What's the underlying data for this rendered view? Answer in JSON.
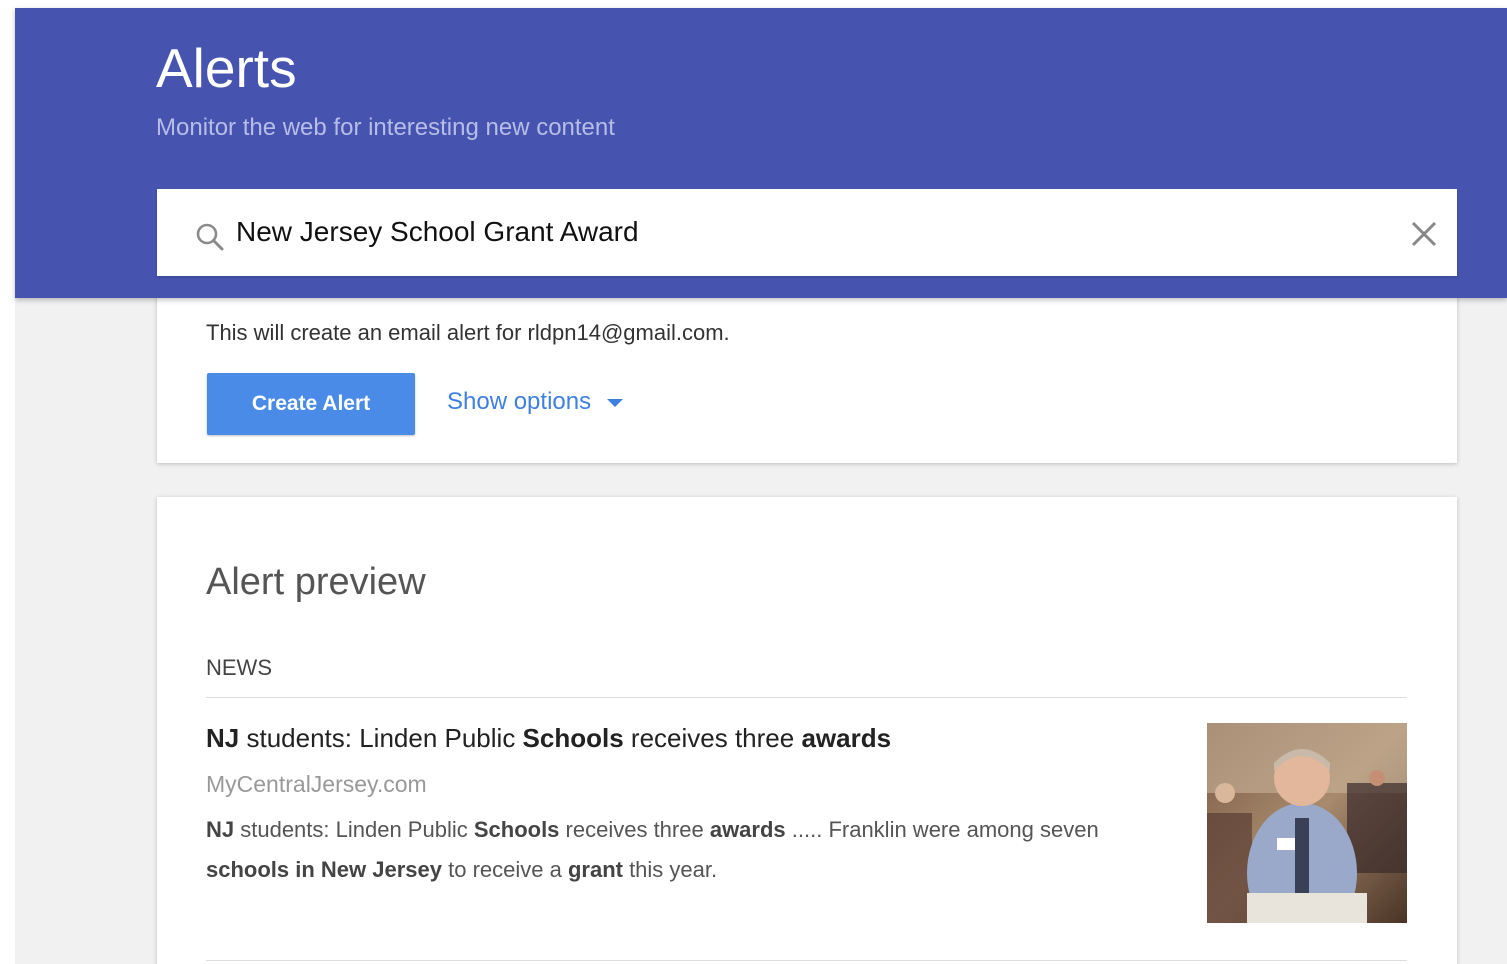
{
  "header": {
    "title": "Alerts",
    "subtitle": "Monitor the web for interesting new content"
  },
  "search": {
    "value": "New Jersey School Grant Award",
    "icon": "search-icon",
    "clear_icon": "close-icon"
  },
  "create_card": {
    "email_note": "This will create an email alert for rldpn14@gmail.com.",
    "create_button": "Create Alert",
    "show_options": "Show options"
  },
  "preview": {
    "title": "Alert preview",
    "section_label": "NEWS",
    "items": [
      {
        "title_parts": [
          {
            "text": "NJ",
            "bold": true
          },
          {
            "text": " students: Linden Public ",
            "bold": false
          },
          {
            "text": "Schools",
            "bold": true
          },
          {
            "text": " receives three ",
            "bold": false
          },
          {
            "text": "awards",
            "bold": true
          }
        ],
        "source": "MyCentralJersey.com",
        "snippet_parts": [
          {
            "text": "NJ",
            "bold": true
          },
          {
            "text": " students: Linden Public ",
            "bold": false
          },
          {
            "text": "Schools",
            "bold": true
          },
          {
            "text": " receives three ",
            "bold": false
          },
          {
            "text": "awards",
            "bold": true
          },
          {
            "text": " ..... Franklin were among seven ",
            "bold": false
          },
          {
            "text": "schools in New Jersey",
            "bold": true
          },
          {
            "text": " to receive a ",
            "bold": false
          },
          {
            "text": "grant",
            "bold": true
          },
          {
            "text": " this year.",
            "bold": false
          }
        ]
      }
    ]
  },
  "colors": {
    "header_bg": "#4654b0",
    "button_bg": "#4a8be8",
    "link": "#3f7fe0",
    "app_bg": "#f1f1f1"
  }
}
